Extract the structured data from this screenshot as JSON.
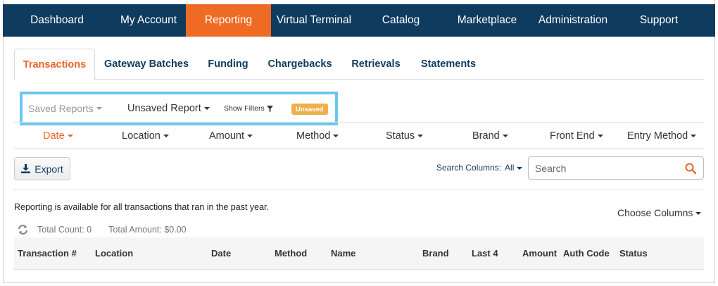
{
  "topnav": {
    "items": [
      {
        "label": "Dashboard"
      },
      {
        "label": "My Account"
      },
      {
        "label": "Reporting"
      },
      {
        "label": "Virtual Terminal"
      },
      {
        "label": "Catalog"
      },
      {
        "label": "Marketplace"
      },
      {
        "label": "Administration"
      },
      {
        "label": "Support"
      }
    ],
    "active": "Reporting",
    "bg_color": "#0f3b5f",
    "active_color": "#ef6b25"
  },
  "subtabs": {
    "items": [
      {
        "label": "Transactions"
      },
      {
        "label": "Gateway Batches"
      },
      {
        "label": "Funding"
      },
      {
        "label": "Chargebacks"
      },
      {
        "label": "Retrievals"
      },
      {
        "label": "Statements"
      }
    ],
    "active": "Transactions"
  },
  "reports": {
    "saved_label": "Saved Reports",
    "current_label": "Unsaved Report",
    "show_filters_label": "Show Filters",
    "status_badge": "Unsaved",
    "highlight_color": "#6bc7ef"
  },
  "column_filters": [
    {
      "label": "Date"
    },
    {
      "label": "Location"
    },
    {
      "label": "Amount"
    },
    {
      "label": "Method"
    },
    {
      "label": "Status"
    },
    {
      "label": "Brand"
    },
    {
      "label": "Front End"
    },
    {
      "label": "Entry Method"
    }
  ],
  "toolbar": {
    "export_label": "Export",
    "search_columns_label": "Search Columns:",
    "search_columns_value": "All",
    "search_placeholder": "Search"
  },
  "info": {
    "message": "Reporting is available for all transactions that ran in the past year.",
    "choose_columns_label": "Choose Columns",
    "total_count": "Total Count: 0",
    "total_amount": "Total Amount: $0.00"
  },
  "table": {
    "columns": [
      "Transaction #",
      "Location",
      "Date",
      "Method",
      "Name",
      "Brand",
      "Last 4",
      "Amount",
      "Auth Code",
      "Status"
    ]
  }
}
